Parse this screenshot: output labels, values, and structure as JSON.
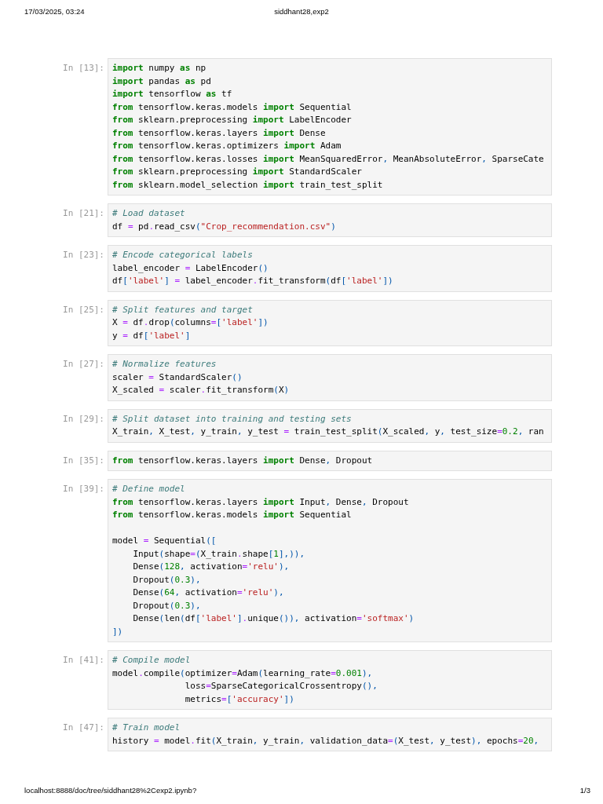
{
  "print_header": {
    "date": "17/03/2025, 03:24",
    "title": "siddhant28,exp2"
  },
  "cells": [
    {
      "prompt": "In [13]:",
      "lines": [
        {
          "kind": "code",
          "tokens": [
            {
              "kind": "kw",
              "text": "import"
            },
            {
              "kind": "txt",
              "text": " numpy "
            },
            {
              "kind": "kw",
              "text": "as"
            },
            {
              "kind": "txt",
              "text": " np"
            }
          ]
        },
        {
          "kind": "code",
          "tokens": [
            {
              "kind": "kw",
              "text": "import"
            },
            {
              "kind": "txt",
              "text": " pandas "
            },
            {
              "kind": "kw",
              "text": "as"
            },
            {
              "kind": "txt",
              "text": " pd"
            }
          ]
        },
        {
          "kind": "code",
          "tokens": [
            {
              "kind": "kw",
              "text": "import"
            },
            {
              "kind": "txt",
              "text": " tensorflow "
            },
            {
              "kind": "kw",
              "text": "as"
            },
            {
              "kind": "txt",
              "text": " tf"
            }
          ]
        },
        {
          "kind": "code",
          "tokens": [
            {
              "kind": "kw",
              "text": "from"
            },
            {
              "kind": "txt",
              "text": " tensorflow.keras.models "
            },
            {
              "kind": "kw",
              "text": "import"
            },
            {
              "kind": "txt",
              "text": " Sequential"
            }
          ]
        },
        {
          "kind": "code",
          "tokens": [
            {
              "kind": "kw",
              "text": "from"
            },
            {
              "kind": "txt",
              "text": " sklearn.preprocessing "
            },
            {
              "kind": "kw",
              "text": "import"
            },
            {
              "kind": "txt",
              "text": " LabelEncoder"
            }
          ]
        },
        {
          "kind": "code",
          "tokens": [
            {
              "kind": "kw",
              "text": "from"
            },
            {
              "kind": "txt",
              "text": " tensorflow.keras.layers "
            },
            {
              "kind": "kw",
              "text": "import"
            },
            {
              "kind": "txt",
              "text": " Dense"
            }
          ]
        },
        {
          "kind": "code",
          "tokens": [
            {
              "kind": "kw",
              "text": "from"
            },
            {
              "kind": "txt",
              "text": " tensorflow.keras.optimizers "
            },
            {
              "kind": "kw",
              "text": "import"
            },
            {
              "kind": "txt",
              "text": " Adam"
            }
          ]
        },
        {
          "kind": "code",
          "tokens": [
            {
              "kind": "kw",
              "text": "from"
            },
            {
              "kind": "txt",
              "text": " tensorflow.keras.losses "
            },
            {
              "kind": "kw",
              "text": "import"
            },
            {
              "kind": "txt",
              "text": " MeanSquaredError"
            },
            {
              "kind": "pun",
              "text": ","
            },
            {
              "kind": "txt",
              "text": " MeanAbsoluteError"
            },
            {
              "kind": "pun",
              "text": ","
            },
            {
              "kind": "txt",
              "text": " SparseCate"
            }
          ]
        },
        {
          "kind": "code",
          "tokens": [
            {
              "kind": "kw",
              "text": "from"
            },
            {
              "kind": "txt",
              "text": " sklearn.preprocessing "
            },
            {
              "kind": "kw",
              "text": "import"
            },
            {
              "kind": "txt",
              "text": " StandardScaler"
            }
          ]
        },
        {
          "kind": "code",
          "tokens": [
            {
              "kind": "kw",
              "text": "from"
            },
            {
              "kind": "txt",
              "text": " sklearn.model_selection "
            },
            {
              "kind": "kw",
              "text": "import"
            },
            {
              "kind": "txt",
              "text": " train_test_split"
            }
          ]
        }
      ]
    },
    {
      "prompt": "In [21]:",
      "lines": [
        {
          "kind": "code",
          "tokens": [
            {
              "kind": "com",
              "text": "# Load dataset"
            }
          ]
        },
        {
          "kind": "code",
          "tokens": [
            {
              "kind": "txt",
              "text": "df "
            },
            {
              "kind": "op",
              "text": "="
            },
            {
              "kind": "txt",
              "text": " pd"
            },
            {
              "kind": "op",
              "text": "."
            },
            {
              "kind": "txt",
              "text": "read_csv"
            },
            {
              "kind": "pun",
              "text": "("
            },
            {
              "kind": "str",
              "text": "\"Crop_recommendation.csv\""
            },
            {
              "kind": "pun",
              "text": ")"
            }
          ]
        }
      ]
    },
    {
      "prompt": "In [23]:",
      "lines": [
        {
          "kind": "code",
          "tokens": [
            {
              "kind": "com",
              "text": "# Encode categorical labels"
            }
          ]
        },
        {
          "kind": "code",
          "tokens": [
            {
              "kind": "txt",
              "text": "label_encoder "
            },
            {
              "kind": "op",
              "text": "="
            },
            {
              "kind": "txt",
              "text": " LabelEncoder"
            },
            {
              "kind": "pun",
              "text": "()"
            }
          ]
        },
        {
          "kind": "code",
          "tokens": [
            {
              "kind": "txt",
              "text": "df"
            },
            {
              "kind": "pun",
              "text": "["
            },
            {
              "kind": "str",
              "text": "'label'"
            },
            {
              "kind": "pun",
              "text": "] "
            },
            {
              "kind": "op",
              "text": "="
            },
            {
              "kind": "txt",
              "text": " label_encoder"
            },
            {
              "kind": "op",
              "text": "."
            },
            {
              "kind": "txt",
              "text": "fit_transform"
            },
            {
              "kind": "pun",
              "text": "("
            },
            {
              "kind": "txt",
              "text": "df"
            },
            {
              "kind": "pun",
              "text": "["
            },
            {
              "kind": "str",
              "text": "'label'"
            },
            {
              "kind": "pun",
              "text": "])"
            }
          ]
        }
      ]
    },
    {
      "prompt": "In [25]:",
      "lines": [
        {
          "kind": "code",
          "tokens": [
            {
              "kind": "com",
              "text": "# Split features and target"
            }
          ]
        },
        {
          "kind": "code",
          "tokens": [
            {
              "kind": "txt",
              "text": "X "
            },
            {
              "kind": "op",
              "text": "="
            },
            {
              "kind": "txt",
              "text": " df"
            },
            {
              "kind": "op",
              "text": "."
            },
            {
              "kind": "txt",
              "text": "drop"
            },
            {
              "kind": "pun",
              "text": "("
            },
            {
              "kind": "txt",
              "text": "columns"
            },
            {
              "kind": "op",
              "text": "="
            },
            {
              "kind": "pun",
              "text": "["
            },
            {
              "kind": "str",
              "text": "'label'"
            },
            {
              "kind": "pun",
              "text": "])"
            }
          ]
        },
        {
          "kind": "code",
          "tokens": [
            {
              "kind": "txt",
              "text": "y "
            },
            {
              "kind": "op",
              "text": "="
            },
            {
              "kind": "txt",
              "text": " df"
            },
            {
              "kind": "pun",
              "text": "["
            },
            {
              "kind": "str",
              "text": "'label'"
            },
            {
              "kind": "pun",
              "text": "]"
            }
          ]
        }
      ]
    },
    {
      "prompt": "In [27]:",
      "lines": [
        {
          "kind": "code",
          "tokens": [
            {
              "kind": "com",
              "text": "# Normalize features"
            }
          ]
        },
        {
          "kind": "code",
          "tokens": [
            {
              "kind": "txt",
              "text": "scaler "
            },
            {
              "kind": "op",
              "text": "="
            },
            {
              "kind": "txt",
              "text": " StandardScaler"
            },
            {
              "kind": "pun",
              "text": "()"
            }
          ]
        },
        {
          "kind": "code",
          "tokens": [
            {
              "kind": "txt",
              "text": "X_scaled "
            },
            {
              "kind": "op",
              "text": "="
            },
            {
              "kind": "txt",
              "text": " scaler"
            },
            {
              "kind": "op",
              "text": "."
            },
            {
              "kind": "txt",
              "text": "fit_transform"
            },
            {
              "kind": "pun",
              "text": "("
            },
            {
              "kind": "txt",
              "text": "X"
            },
            {
              "kind": "pun",
              "text": ")"
            }
          ]
        }
      ]
    },
    {
      "prompt": "In [29]:",
      "lines": [
        {
          "kind": "code",
          "tokens": [
            {
              "kind": "com",
              "text": "# Split dataset into training and testing sets"
            }
          ]
        },
        {
          "kind": "code",
          "tokens": [
            {
              "kind": "txt",
              "text": "X_train"
            },
            {
              "kind": "pun",
              "text": ","
            },
            {
              "kind": "txt",
              "text": " X_test"
            },
            {
              "kind": "pun",
              "text": ","
            },
            {
              "kind": "txt",
              "text": " y_train"
            },
            {
              "kind": "pun",
              "text": ","
            },
            {
              "kind": "txt",
              "text": " y_test "
            },
            {
              "kind": "op",
              "text": "="
            },
            {
              "kind": "txt",
              "text": " train_test_split"
            },
            {
              "kind": "pun",
              "text": "("
            },
            {
              "kind": "txt",
              "text": "X_scaled"
            },
            {
              "kind": "pun",
              "text": ","
            },
            {
              "kind": "txt",
              "text": " y"
            },
            {
              "kind": "pun",
              "text": ","
            },
            {
              "kind": "txt",
              "text": " test_size"
            },
            {
              "kind": "op",
              "text": "="
            },
            {
              "kind": "num",
              "text": "0.2"
            },
            {
              "kind": "pun",
              "text": ","
            },
            {
              "kind": "txt",
              "text": " ran"
            }
          ]
        }
      ]
    },
    {
      "prompt": "In [35]:",
      "lines": [
        {
          "kind": "code",
          "tokens": [
            {
              "kind": "kw",
              "text": "from"
            },
            {
              "kind": "txt",
              "text": " tensorflow.keras.layers "
            },
            {
              "kind": "kw",
              "text": "import"
            },
            {
              "kind": "txt",
              "text": " Dense"
            },
            {
              "kind": "pun",
              "text": ","
            },
            {
              "kind": "txt",
              "text": " Dropout"
            }
          ]
        }
      ]
    },
    {
      "prompt": "In [39]:",
      "lines": [
        {
          "kind": "code",
          "tokens": [
            {
              "kind": "com",
              "text": "# Define model"
            }
          ]
        },
        {
          "kind": "code",
          "tokens": [
            {
              "kind": "kw",
              "text": "from"
            },
            {
              "kind": "txt",
              "text": " tensorflow.keras.layers "
            },
            {
              "kind": "kw",
              "text": "import"
            },
            {
              "kind": "txt",
              "text": " Input"
            },
            {
              "kind": "pun",
              "text": ","
            },
            {
              "kind": "txt",
              "text": " Dense"
            },
            {
              "kind": "pun",
              "text": ","
            },
            {
              "kind": "txt",
              "text": " Dropout"
            }
          ]
        },
        {
          "kind": "code",
          "tokens": [
            {
              "kind": "kw",
              "text": "from"
            },
            {
              "kind": "txt",
              "text": " tensorflow.keras.models "
            },
            {
              "kind": "kw",
              "text": "import"
            },
            {
              "kind": "txt",
              "text": " Sequential"
            }
          ]
        },
        {
          "kind": "blank"
        },
        {
          "kind": "code",
          "tokens": [
            {
              "kind": "txt",
              "text": "model "
            },
            {
              "kind": "op",
              "text": "="
            },
            {
              "kind": "txt",
              "text": " Sequential"
            },
            {
              "kind": "pun",
              "text": "(["
            }
          ]
        },
        {
          "kind": "code",
          "tokens": [
            {
              "kind": "txt",
              "text": "    Input"
            },
            {
              "kind": "pun",
              "text": "("
            },
            {
              "kind": "txt",
              "text": "shape"
            },
            {
              "kind": "op",
              "text": "="
            },
            {
              "kind": "pun",
              "text": "("
            },
            {
              "kind": "txt",
              "text": "X_train"
            },
            {
              "kind": "op",
              "text": "."
            },
            {
              "kind": "txt",
              "text": "shape"
            },
            {
              "kind": "pun",
              "text": "["
            },
            {
              "kind": "num",
              "text": "1"
            },
            {
              "kind": "pun",
              "text": "],)),"
            }
          ]
        },
        {
          "kind": "code",
          "tokens": [
            {
              "kind": "txt",
              "text": "    Dense"
            },
            {
              "kind": "pun",
              "text": "("
            },
            {
              "kind": "num",
              "text": "128"
            },
            {
              "kind": "pun",
              "text": ","
            },
            {
              "kind": "txt",
              "text": " activation"
            },
            {
              "kind": "op",
              "text": "="
            },
            {
              "kind": "str",
              "text": "'relu'"
            },
            {
              "kind": "pun",
              "text": "),"
            }
          ]
        },
        {
          "kind": "code",
          "tokens": [
            {
              "kind": "txt",
              "text": "    Dropout"
            },
            {
              "kind": "pun",
              "text": "("
            },
            {
              "kind": "num",
              "text": "0.3"
            },
            {
              "kind": "pun",
              "text": "),"
            }
          ]
        },
        {
          "kind": "code",
          "tokens": [
            {
              "kind": "txt",
              "text": "    Dense"
            },
            {
              "kind": "pun",
              "text": "("
            },
            {
              "kind": "num",
              "text": "64"
            },
            {
              "kind": "pun",
              "text": ","
            },
            {
              "kind": "txt",
              "text": " activation"
            },
            {
              "kind": "op",
              "text": "="
            },
            {
              "kind": "str",
              "text": "'relu'"
            },
            {
              "kind": "pun",
              "text": "),"
            }
          ]
        },
        {
          "kind": "code",
          "tokens": [
            {
              "kind": "txt",
              "text": "    Dropout"
            },
            {
              "kind": "pun",
              "text": "("
            },
            {
              "kind": "num",
              "text": "0.3"
            },
            {
              "kind": "pun",
              "text": "),"
            }
          ]
        },
        {
          "kind": "code",
          "tokens": [
            {
              "kind": "txt",
              "text": "    Dense"
            },
            {
              "kind": "pun",
              "text": "("
            },
            {
              "kind": "txt",
              "text": "len"
            },
            {
              "kind": "pun",
              "text": "("
            },
            {
              "kind": "txt",
              "text": "df"
            },
            {
              "kind": "pun",
              "text": "["
            },
            {
              "kind": "str",
              "text": "'label'"
            },
            {
              "kind": "pun",
              "text": "]"
            },
            {
              "kind": "op",
              "text": "."
            },
            {
              "kind": "txt",
              "text": "unique"
            },
            {
              "kind": "pun",
              "text": "()),"
            },
            {
              "kind": "txt",
              "text": " activation"
            },
            {
              "kind": "op",
              "text": "="
            },
            {
              "kind": "str",
              "text": "'softmax'"
            },
            {
              "kind": "pun",
              "text": ")"
            }
          ]
        },
        {
          "kind": "code",
          "tokens": [
            {
              "kind": "pun",
              "text": "])"
            }
          ]
        }
      ]
    },
    {
      "prompt": "In [41]:",
      "lines": [
        {
          "kind": "code",
          "tokens": [
            {
              "kind": "com",
              "text": "# Compile model"
            }
          ]
        },
        {
          "kind": "code",
          "tokens": [
            {
              "kind": "txt",
              "text": "model"
            },
            {
              "kind": "op",
              "text": "."
            },
            {
              "kind": "txt",
              "text": "compile"
            },
            {
              "kind": "pun",
              "text": "("
            },
            {
              "kind": "txt",
              "text": "optimizer"
            },
            {
              "kind": "op",
              "text": "="
            },
            {
              "kind": "txt",
              "text": "Adam"
            },
            {
              "kind": "pun",
              "text": "("
            },
            {
              "kind": "txt",
              "text": "learning_rate"
            },
            {
              "kind": "op",
              "text": "="
            },
            {
              "kind": "num",
              "text": "0.001"
            },
            {
              "kind": "pun",
              "text": "),"
            }
          ]
        },
        {
          "kind": "code",
          "tokens": [
            {
              "kind": "txt",
              "text": "              loss"
            },
            {
              "kind": "op",
              "text": "="
            },
            {
              "kind": "txt",
              "text": "SparseCategoricalCrossentropy"
            },
            {
              "kind": "pun",
              "text": "(),"
            }
          ]
        },
        {
          "kind": "code",
          "tokens": [
            {
              "kind": "txt",
              "text": "              metrics"
            },
            {
              "kind": "op",
              "text": "="
            },
            {
              "kind": "pun",
              "text": "["
            },
            {
              "kind": "str",
              "text": "'accuracy'"
            },
            {
              "kind": "pun",
              "text": "])"
            }
          ]
        }
      ]
    },
    {
      "prompt": "In [47]:",
      "lines": [
        {
          "kind": "code",
          "tokens": [
            {
              "kind": "com",
              "text": "# Train model"
            }
          ]
        },
        {
          "kind": "code",
          "tokens": [
            {
              "kind": "txt",
              "text": "history "
            },
            {
              "kind": "op",
              "text": "="
            },
            {
              "kind": "txt",
              "text": " model"
            },
            {
              "kind": "op",
              "text": "."
            },
            {
              "kind": "txt",
              "text": "fit"
            },
            {
              "kind": "pun",
              "text": "("
            },
            {
              "kind": "txt",
              "text": "X_train"
            },
            {
              "kind": "pun",
              "text": ","
            },
            {
              "kind": "txt",
              "text": " y_train"
            },
            {
              "kind": "pun",
              "text": ","
            },
            {
              "kind": "txt",
              "text": " validation_data"
            },
            {
              "kind": "op",
              "text": "="
            },
            {
              "kind": "pun",
              "text": "("
            },
            {
              "kind": "txt",
              "text": "X_test"
            },
            {
              "kind": "pun",
              "text": ","
            },
            {
              "kind": "txt",
              "text": " y_test"
            },
            {
              "kind": "pun",
              "text": "),"
            },
            {
              "kind": "txt",
              "text": " epochs"
            },
            {
              "kind": "op",
              "text": "="
            },
            {
              "kind": "num",
              "text": "20"
            },
            {
              "kind": "pun",
              "text": ","
            }
          ]
        }
      ]
    }
  ],
  "print_footer": {
    "url": "localhost:8888/doc/tree/siddhant28%2Cexp2.ipynb?",
    "page": "1/3"
  }
}
